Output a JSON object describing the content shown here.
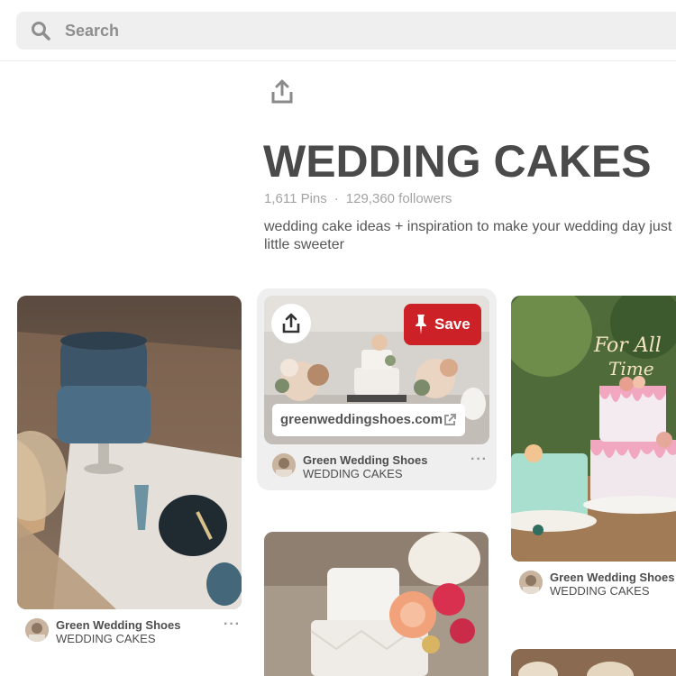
{
  "search": {
    "placeholder": "Search"
  },
  "board": {
    "title": "WEDDING CAKES",
    "pins": "1,611 Pins",
    "separator": "·",
    "followers": "129,360 followers",
    "description": "wedding cake ideas + inspiration to make your wedding day just a little sweeter"
  },
  "pins": [
    {
      "pinner": "Green Wedding Shoes",
      "board": "WEDDING CAKES",
      "more": "···"
    },
    {
      "pinner": "Green Wedding Shoes",
      "board": "WEDDING CAKES",
      "more": "···",
      "save_label": "Save",
      "link": "greenweddingshoes.com"
    },
    {
      "pinner": "Green Wedding Shoes",
      "board": "WEDDING CAKES"
    }
  ],
  "colors": {
    "save": "#cc2127",
    "search_bg": "#efefef",
    "title": "#4a4a4a"
  },
  "icons": {
    "search": "search-icon",
    "share": "share-icon",
    "pin": "pin-icon",
    "external": "external-link-icon"
  }
}
